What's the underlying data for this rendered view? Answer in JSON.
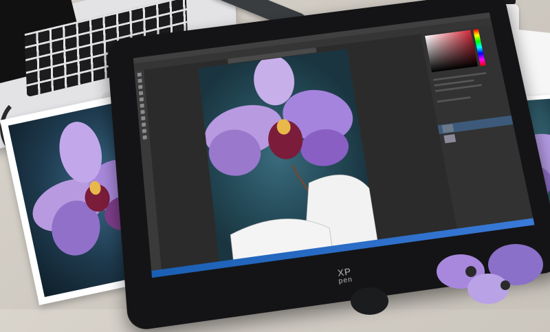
{
  "scene": {
    "description_tags": [
      "pen-display",
      "laptop",
      "orchid-print",
      "desk"
    ]
  },
  "tablet": {
    "brand_line1": "XP",
    "brand_line2": "pen"
  },
  "photoshop": {
    "document_tab": "",
    "panels": [
      "color",
      "properties",
      "layers"
    ]
  },
  "icons": {
    "tools": [
      "move-tool-icon",
      "marquee-tool-icon",
      "lasso-tool-icon",
      "crop-tool-icon",
      "eyedropper-tool-icon",
      "brush-tool-icon",
      "eraser-tool-icon",
      "gradient-tool-icon",
      "text-tool-icon",
      "hand-tool-icon",
      "zoom-tool-icon"
    ]
  },
  "colors": {
    "orchid_purple": "#8a5fc4",
    "orchid_light": "#c7b0ea",
    "orchid_center": "#7a1c3a",
    "orchid_yellow": "#e8b84a",
    "taskbar_blue": "#1a5fb4",
    "ps_dark": "#2b2b2b"
  }
}
